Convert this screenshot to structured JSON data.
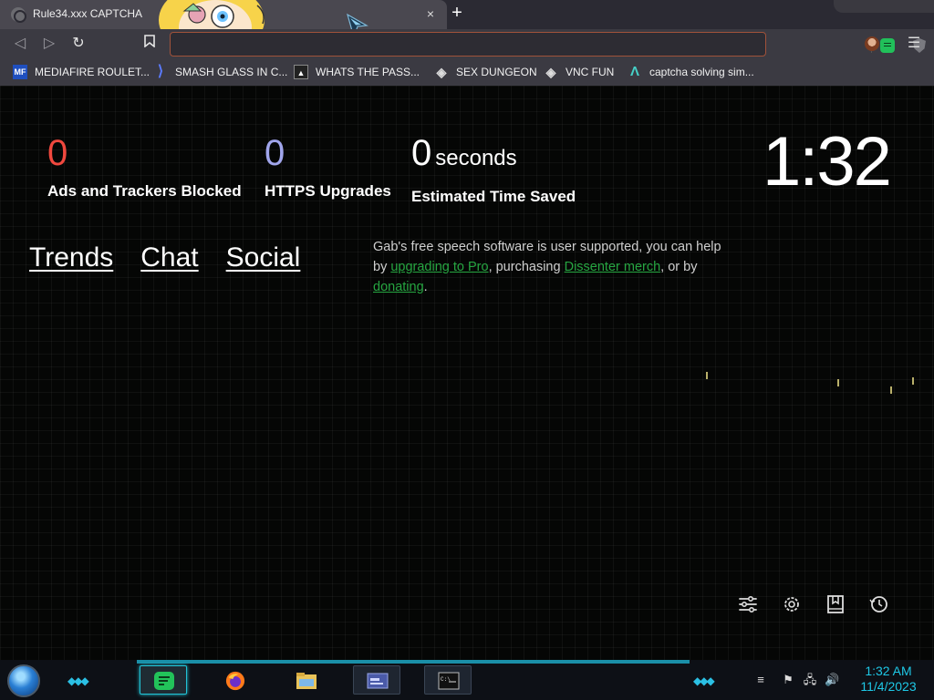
{
  "browser": {
    "tab_title": "Rule34.xxx CAPTCHA",
    "tab_close": "×",
    "new_tab": "+",
    "bookmarks": [
      {
        "label": "MEDIAFIRE ROULET...",
        "icon": "mediafire-icon",
        "icon_text": "MF"
      },
      {
        "label": "SMASH GLASS IN C...",
        "icon": "smash-icon",
        "icon_text": "⟩"
      },
      {
        "label": "WHATS THE PASS...",
        "icon": "password-icon",
        "icon_text": "▲"
      },
      {
        "label": "SEX DUNGEON",
        "icon": "cube-icon",
        "icon_text": "◈"
      },
      {
        "label": "VNC FUN",
        "icon": "cube-icon",
        "icon_text": "◈"
      },
      {
        "label": "captcha solving sim...",
        "icon": "lambda-icon",
        "icon_text": "Λ"
      }
    ]
  },
  "stats": {
    "ads": {
      "value": "0",
      "label": "Ads and Trackers Blocked",
      "color": "#f0483e"
    },
    "https": {
      "value": "0",
      "label": "HTTPS Upgrades",
      "color": "#a0a5eb"
    },
    "time": {
      "value": "0",
      "unit": "seconds",
      "label": "Estimated Time Saved"
    }
  },
  "clock": "1:32",
  "nav": {
    "trends": "Trends",
    "chat": "Chat",
    "social": "Social"
  },
  "gab": {
    "text1": "Gab's free speech software is user supported, you can help by ",
    "link1": "upgrading to Pro",
    "text2": ", purchasing ",
    "link2": "Dissenter merch",
    "text3": ", or by ",
    "link3": "donating",
    "text4": ".",
    "link_color": "#26a641"
  },
  "taskbar": {
    "time": "1:32 AM",
    "date": "11/4/2023",
    "accent": "#1ec8e6"
  }
}
